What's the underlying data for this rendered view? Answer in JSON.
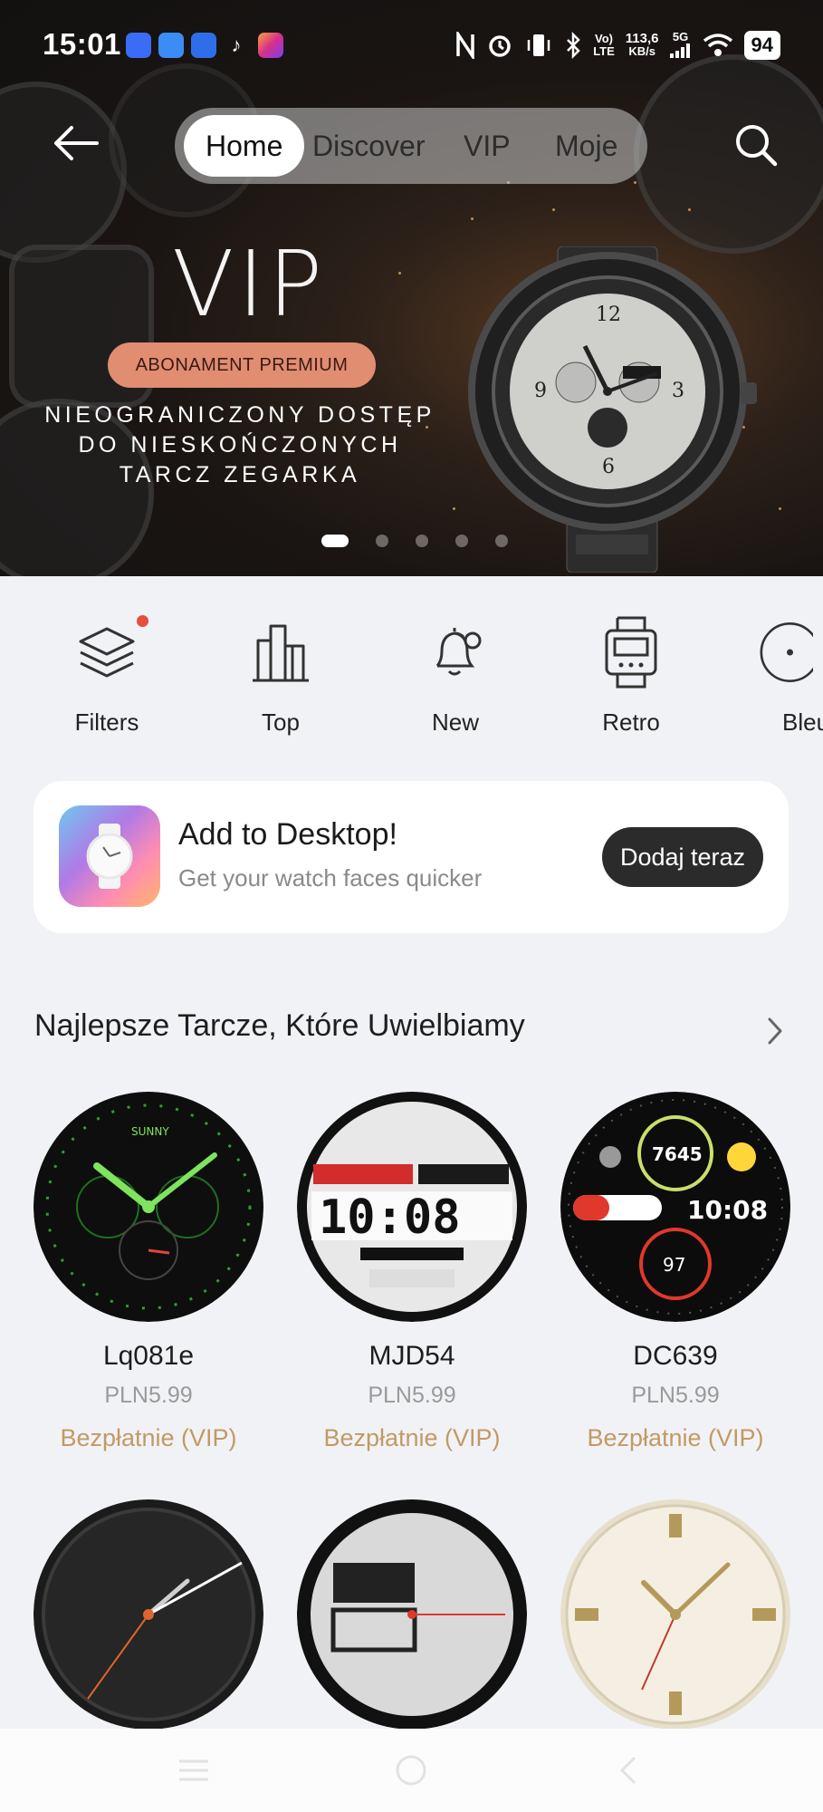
{
  "status_bar": {
    "time": "15:01",
    "net_speed": "113,6",
    "net_unit": "KB/s",
    "signal_label": "5G",
    "volte": "Vo)",
    "lte": "LTE",
    "battery": "94"
  },
  "nav": {
    "tabs": [
      {
        "label": "Home",
        "active": true
      },
      {
        "label": "Discover",
        "active": false
      },
      {
        "label": "VIP",
        "active": false
      },
      {
        "label": "Moje",
        "active": false
      }
    ]
  },
  "banner": {
    "title": "VIP",
    "badge": "ABONAMENT PREMIUM",
    "lines": [
      "NIEOGRANICZONY DOSTĘP",
      "DO NIESKOŃCZONYCH",
      "TARCZ ZEGARKA"
    ],
    "page_count": 5,
    "active_page": 0,
    "accent_color": "#e08d72"
  },
  "categories": [
    {
      "label": "Filters",
      "icon": "layers-icon",
      "badge": true
    },
    {
      "label": "Top",
      "icon": "buildings-icon",
      "badge": false
    },
    {
      "label": "New",
      "icon": "bell-icon",
      "badge": false
    },
    {
      "label": "Retro",
      "icon": "digital-watch-icon",
      "badge": false
    },
    {
      "label": "Bleu",
      "icon": "circle-dot-icon",
      "badge": false
    }
  ],
  "desktop_card": {
    "title": "Add to Desktop!",
    "subtitle": "Get your watch faces quicker",
    "button": "Dodaj teraz"
  },
  "section": {
    "title": "Najlepsze Tarcze, Które Uwielbiamy"
  },
  "watchfaces": [
    {
      "name": "Lq081e",
      "price": "PLN5.99",
      "vip": "Bezpłatnie (VIP)"
    },
    {
      "name": "MJD54",
      "price": "PLN5.99",
      "vip": "Bezpłatnie (VIP)"
    },
    {
      "name": "DC639",
      "price": "PLN5.99",
      "vip": "Bezpłatnie (VIP)"
    }
  ],
  "colors": {
    "vip_text": "#c19a66",
    "badge_red": "#e5503e",
    "cta_bg": "#2b2b2b"
  }
}
